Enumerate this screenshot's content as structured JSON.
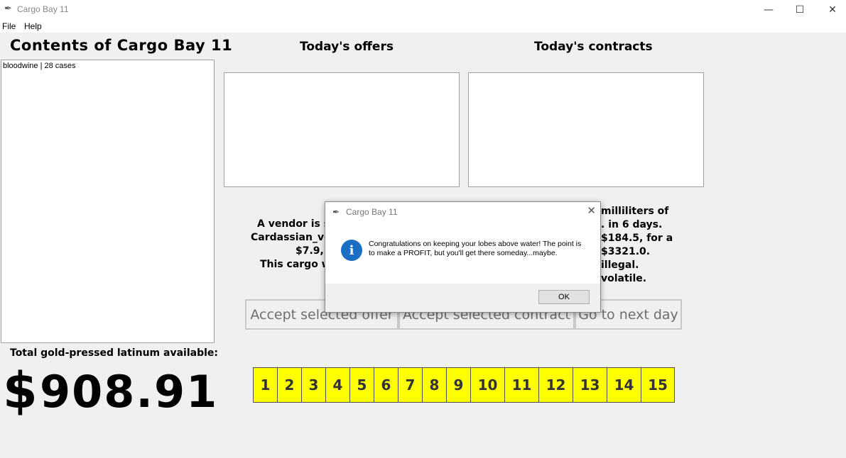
{
  "window": {
    "title": "Cargo Bay 11",
    "icon": "feather-icon",
    "controls": {
      "minimize": "—",
      "maximize": "☐",
      "close": "✕"
    }
  },
  "menu": {
    "items": [
      "File",
      "Help"
    ]
  },
  "cargo": {
    "title": "Contents of Cargo Bay 11",
    "items": [
      "bloodwine | 28 cases"
    ]
  },
  "offers": {
    "title": "Today's offers"
  },
  "contracts": {
    "title": "Today's contracts"
  },
  "offer_desc": {
    "line1": "A vendor is se",
    "line2": "Cardassian_vo",
    "line3": "$7.9, t",
    "line4": "This cargo w"
  },
  "contract_desc": {
    "line1": "milliliters of",
    "line2": ". in 6 days.",
    "line3": "$184.5, for a",
    "line4": "$3321.0.",
    "line5": "illegal.",
    "line6": "volatile."
  },
  "buttons": {
    "accept_offer": "Accept selected offer",
    "accept_contract": "Accept selected contract",
    "next_day": "Go to next day"
  },
  "wallet": {
    "label": "Total gold-pressed latinum available:",
    "currency_symbol": "$",
    "amount": "908.91"
  },
  "days": [
    "1",
    "2",
    "3",
    "4",
    "5",
    "6",
    "7",
    "8",
    "9",
    "10",
    "11",
    "12",
    "13",
    "14",
    "15"
  ],
  "dialog": {
    "title": "Cargo Bay 11",
    "icon": "info-icon",
    "message": "Congratulations on keeping your lobes above water! The point is to make a PROFIT, but you'll get there someday...maybe.",
    "ok_label": "OK",
    "close_glyph": "✕"
  },
  "colors": {
    "day_button": "#ffff00",
    "info_icon": "#1a6fc4"
  }
}
